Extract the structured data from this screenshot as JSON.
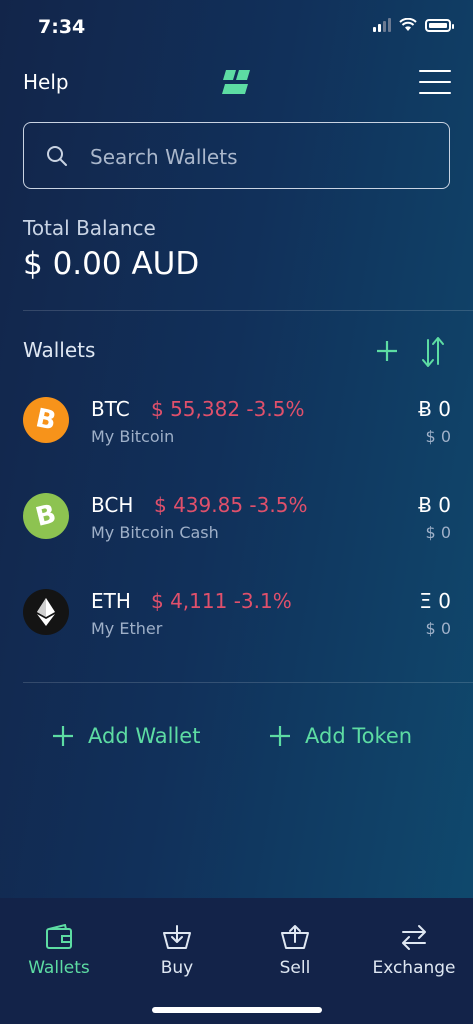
{
  "status": {
    "time": "7:34"
  },
  "header": {
    "help_label": "Help"
  },
  "search": {
    "placeholder": "Search Wallets"
  },
  "balance": {
    "label": "Total Balance",
    "value": "$ 0.00 AUD"
  },
  "wallets": {
    "title": "Wallets",
    "items": [
      {
        "symbol": "BTC",
        "price": "$ 55,382",
        "change": "-3.5%",
        "name": "My Bitcoin",
        "balance": "Ƀ 0",
        "fiat": "$ 0",
        "icon": "bitcoin-icon",
        "color": "#f7931a"
      },
      {
        "symbol": "BCH",
        "price": "$ 439.85",
        "change": "-3.5%",
        "name": "My Bitcoin Cash",
        "balance": "Ƀ 0",
        "fiat": "$ 0",
        "icon": "bitcoin-cash-icon",
        "color": "#8dc351"
      },
      {
        "symbol": "ETH",
        "price": "$ 4,111",
        "change": "-3.1%",
        "name": "My Ether",
        "balance": "Ξ 0",
        "fiat": "$ 0",
        "icon": "ethereum-icon",
        "color": "#141414"
      }
    ]
  },
  "actions": {
    "add_wallet": "Add Wallet",
    "add_token": "Add Token"
  },
  "tabs": [
    {
      "label": "Wallets",
      "icon": "wallet-icon",
      "active": true
    },
    {
      "label": "Buy",
      "icon": "basket-download-icon",
      "active": false
    },
    {
      "label": "Sell",
      "icon": "basket-upload-icon",
      "active": false
    },
    {
      "label": "Exchange",
      "icon": "exchange-arrows-icon",
      "active": false
    }
  ],
  "colors": {
    "accent": "#5ddca3",
    "negative": "#e0506b"
  }
}
